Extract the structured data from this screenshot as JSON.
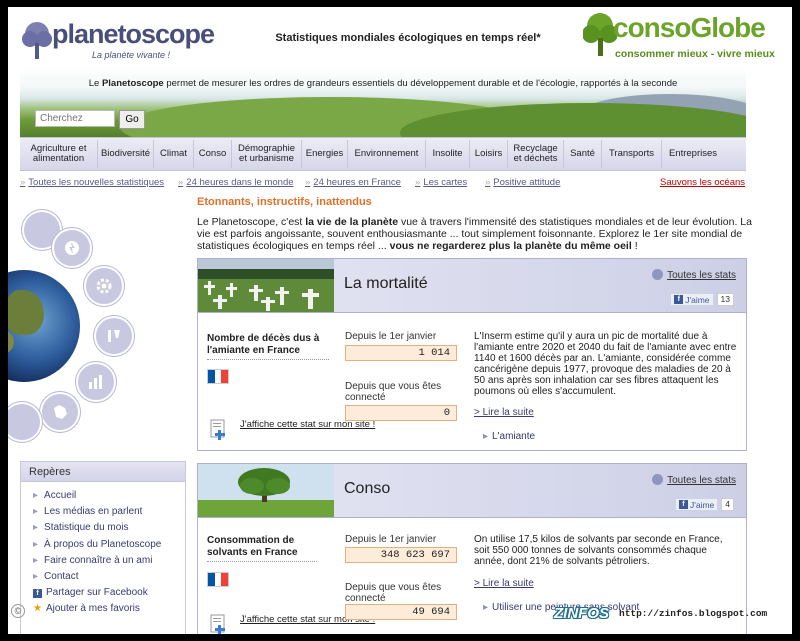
{
  "header": {
    "logo_left": "planetoscope",
    "logo_left_tagline": "La planète vivante !",
    "title": "Statistiques mondiales écologiques en temps réel*",
    "logo_right": "consoGlobe",
    "logo_right_tagline": "consommer mieux - vivre mieux"
  },
  "banner": {
    "text_pre": "Le ",
    "text_bold": "Planetoscope",
    "text_post": " permet de mesurer les ordres de grandeurs essentiels du développement durable et de l'écologie, rapportés à la seconde"
  },
  "search": {
    "placeholder": "Cherchez",
    "button": "Go"
  },
  "nav": [
    "Agriculture et alimentation",
    "Biodiversité",
    "Climat",
    "Conso",
    "Démographie et urbanisme",
    "Energies",
    "Environnement",
    "Insolite",
    "Loisirs",
    "Recyclage et déchets",
    "Santé",
    "Transports",
    "Entreprises"
  ],
  "subnav": [
    "Toutes les nouvelles statistiques",
    "24 heures dans le monde",
    "24 heures en France",
    "Les cartes",
    "Positive attitude"
  ],
  "subnav_red": "Sauvons les océans",
  "intro": {
    "title": "Etonnants, instructifs, inattendus",
    "p1": "Le Planetoscope, c'est ",
    "p1_bold": "la vie de la planète",
    "p2": " vue à travers l'immensité des statistiques mondiales et de leur évolution. La vie est parfois angoissante, souvent enthousiasmante ... tout simplement foisonnante.  Explorez le 1er site mondial de statistiques écologiques en temps réel  ... ",
    "p2_bold": "vous ne regarderez plus la planète du même oeil",
    "p3": " !"
  },
  "boxes": [
    {
      "title": "La mortalité",
      "all_label": "Toutes les stats",
      "like_label": "J'aime",
      "like_count": "13",
      "stat_name": "Nombre de décès dus à l'amiante en France",
      "since_jan_label": "Depuis le 1er janvier",
      "since_jan_value": "1 014",
      "since_conn_label": "Depuis que vous êtes connecté",
      "since_conn_value": "0",
      "share_label": "J'affiche cette stat sur mon site !",
      "description": "L'Inserm estime qu'il y aura un pic de mortalité due à l'amiante entre 2020 et 2040 du fait de l'amiante avec entre 1140 et 1600 décès par an. L'amiante, considérée comme cancérigène depuis 1977, provoque des maladies de 20 à 50 ans après son inhalation car ses fibres attaquent les poumons où elles s'accumulent.",
      "read_more": "> Lire la suite",
      "related": "L'amiante"
    },
    {
      "title": "Conso",
      "all_label": "Toutes les stats",
      "like_label": "J'aime",
      "like_count": "4",
      "stat_name": "Consommation de solvants en France",
      "since_jan_label": "Depuis le 1er janvier",
      "since_jan_value": "348 623 697",
      "since_conn_label": "Depuis que vous êtes connecté",
      "since_conn_value": "49 694",
      "share_label": "J'affiche cette stat sur mon site !",
      "description": "On utilise 17,5 kilos de solvants par seconde en France, soit 550 000 tonnes de solvants consommés chaque année, dont 21% de solvants pétroliers.",
      "read_more": "> Lire la suite",
      "related": "Utiliser une peinture sans solvant"
    }
  ],
  "reperes": {
    "title": "Repères",
    "items": [
      "Accueil",
      "Les médias en parlent",
      "Statistique du mois",
      "À propos du Planetoscope",
      "Faire connaître à un ami",
      "Contact",
      "Partager sur Facebook",
      "Ajouter à mes favoris"
    ]
  },
  "watermark": {
    "brand": "ZINFOS",
    "url": "http://zinfos.blogspot.com"
  },
  "colors": {
    "accent_orange": "#e0712a",
    "nav_bg": "#dcdcee",
    "link": "#5a5a88",
    "red": "#c00000",
    "green": "#6ba32b"
  }
}
